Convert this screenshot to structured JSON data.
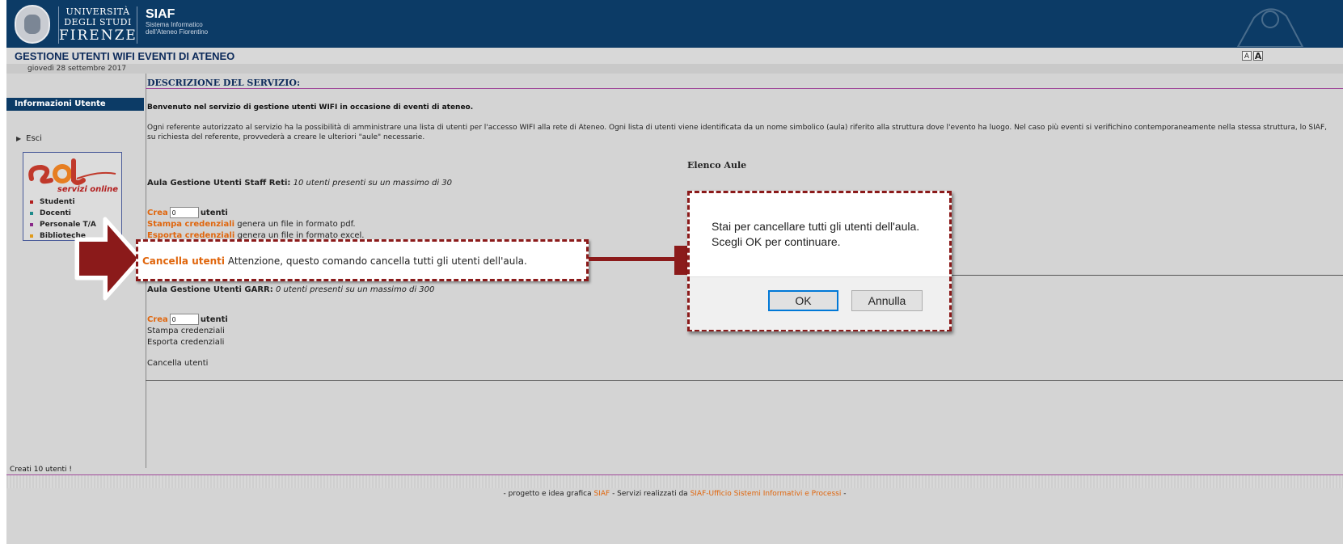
{
  "header": {
    "university_line1": "UNIVERSITÀ",
    "university_line2": "DEGLI STUDI",
    "university_line3": "FIRENZE",
    "siaf_title": "SIAF",
    "siaf_sub1": "Sistema Informatico",
    "siaf_sub2": "dell'Ateneo Fiorentino",
    "app_title": "GESTIONE UTENTI WIFI EVENTI DI ATENEO",
    "date": "giovedì 28 settembre 2017",
    "font_small": "A",
    "font_large": "A"
  },
  "sidebar": {
    "nav_header": "Informazioni Utente",
    "esci": "Esci",
    "sol_text": "servizi online",
    "sol_items": [
      {
        "label": "Studenti",
        "color": "#b21e1e"
      },
      {
        "label": "Docenti",
        "color": "#1e8a8a"
      },
      {
        "label": "Personale T/A",
        "color": "#8a2a8a"
      },
      {
        "label": "Biblioteche",
        "color": "#e09a1a"
      }
    ]
  },
  "content": {
    "section_title": "DESCRIZIONE DEL SERVIZIO:",
    "welcome": "Benvenuto nel servizio di gestione utenti WIFI in occasione di eventi di ateneo.",
    "description": "Ogni referente autorizzato al servizio ha la possibilità di amministrare una lista di utenti per l'accesso WIFI alla rete di Ateneo. Ogni lista di utenti viene identificata da un nome simbolico (aula) riferito alla struttura dove l'evento ha luogo. Nel caso più eventi si verifichino contemporaneamente nella stessa struttura, lo SIAF, su richiesta del referente, provvederà a creare le ulteriori \"aule\" necessarie.",
    "elenco_aule": "Elenco Aule",
    "aula1": {
      "name": "Aula Gestione Utenti Staff Reti:",
      "info": "10 utenti presenti su un massimo di 30",
      "crea": "Crea",
      "crea_value": "0",
      "utenti": "utenti",
      "stampa": "Stampa credenziali",
      "stampa_desc": "genera un file in formato pdf.",
      "esporta": "Esporta credenziali",
      "esporta_desc": "genera un file in formato excel."
    },
    "aula2": {
      "name": "Aula Gestione Utenti GARR:",
      "info": "0 utenti presenti su un massimo di 300",
      "crea": "Crea",
      "crea_value": "0",
      "utenti": "utenti",
      "stampa": "Stampa credenziali",
      "esporta": "Esporta credenziali",
      "cancella": "Cancella utenti"
    }
  },
  "callout": {
    "cancella": "Cancella utenti",
    "warning": "Attenzione, questo comando cancella tutti gli utenti dell'aula."
  },
  "dialog": {
    "line1": "Stai per cancellare tutti gli utenti dell'aula.",
    "line2": "Scegli OK per continuare.",
    "ok": "OK",
    "cancel": "Annulla"
  },
  "status": "Creati 10 utenti !",
  "footer": {
    "prefix": "- progetto e idea grafica",
    "siaf": "SIAF",
    "middle": "- Servizi realizzati da",
    "siaf_full": "SIAF-Ufficio Sistemi Informativi e Processi",
    "suffix": "-"
  },
  "colors": {
    "header": "#0c3b66",
    "accent_orange": "#e0660d",
    "callout_border": "#8b1a1a"
  }
}
